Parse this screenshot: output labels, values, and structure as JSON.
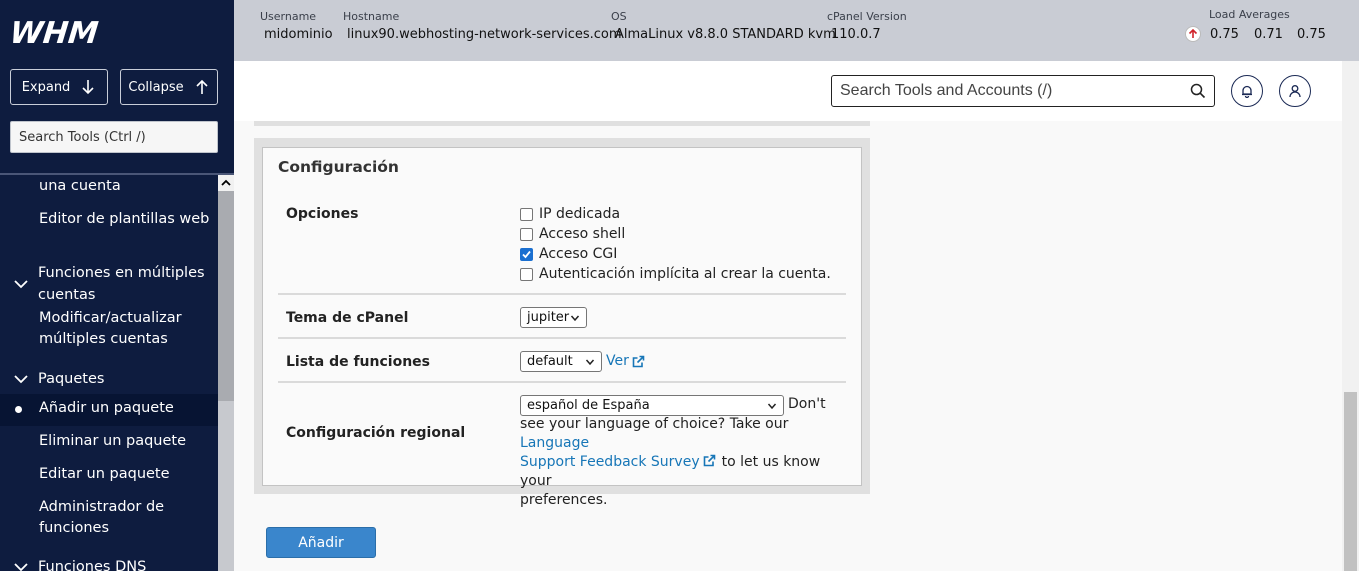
{
  "sidebar": {
    "logo": "WHM",
    "expand_label": "Expand",
    "collapse_label": "Collapse",
    "search_placeholder": "Search Tools (Ctrl /)",
    "items": [
      {
        "label": "una cuenta"
      },
      {
        "label": "Editor de plantillas web"
      },
      {
        "label": "Funciones en múltiples cuentas",
        "group": true
      },
      {
        "label": "Modificar/actualizar múltiples cuentas"
      },
      {
        "label": "Paquetes",
        "group": true
      },
      {
        "label": "Añadir un paquete",
        "active": true
      },
      {
        "label": "Eliminar un paquete"
      },
      {
        "label": "Editar un paquete"
      },
      {
        "label": "Administrador de funciones"
      },
      {
        "label": "Funciones DNS",
        "group": true
      }
    ]
  },
  "topbar": {
    "username_label": "Username",
    "username": "midominio",
    "hostname_label": "Hostname",
    "hostname": "linux90.webhosting-network-services.com",
    "os_label": "OS",
    "os": "AlmaLinux v8.8.0 STANDARD kvm",
    "cpanel_label": "cPanel Version",
    "cpanel_version": "110.0.7",
    "load_label": "Load Averages",
    "load": [
      "0.75",
      "0.71",
      "0.75"
    ]
  },
  "header": {
    "search_placeholder": "Search Tools and Accounts (/)"
  },
  "panel": {
    "title": "Configuración",
    "opciones_label": "Opciones",
    "options": [
      {
        "label": "IP dedicada",
        "checked": false
      },
      {
        "label": "Acceso shell",
        "checked": false
      },
      {
        "label": "Acceso CGI",
        "checked": true
      },
      {
        "label": "Autenticación implícita al crear la cuenta.",
        "checked": false
      }
    ],
    "tema_label": "Tema de cPanel",
    "tema_value": "jupiter",
    "lista_label": "Lista de funciones",
    "lista_value": "default",
    "ver_link": "Ver",
    "regional_label": "Configuración regional",
    "regional_value": "español de España",
    "regional_dont": "Don't",
    "regional_text_1": "see your language of choice? Take our",
    "regional_link_1": "Language",
    "regional_link_2": "Support Feedback Survey",
    "regional_text_2": "to let us know your",
    "regional_text_3": "preferences."
  },
  "submit_label": "Añadir",
  "colors": {
    "sidebar_bg": "#0e1c3f",
    "accent": "#3a86cc",
    "link": "#1776b7"
  }
}
